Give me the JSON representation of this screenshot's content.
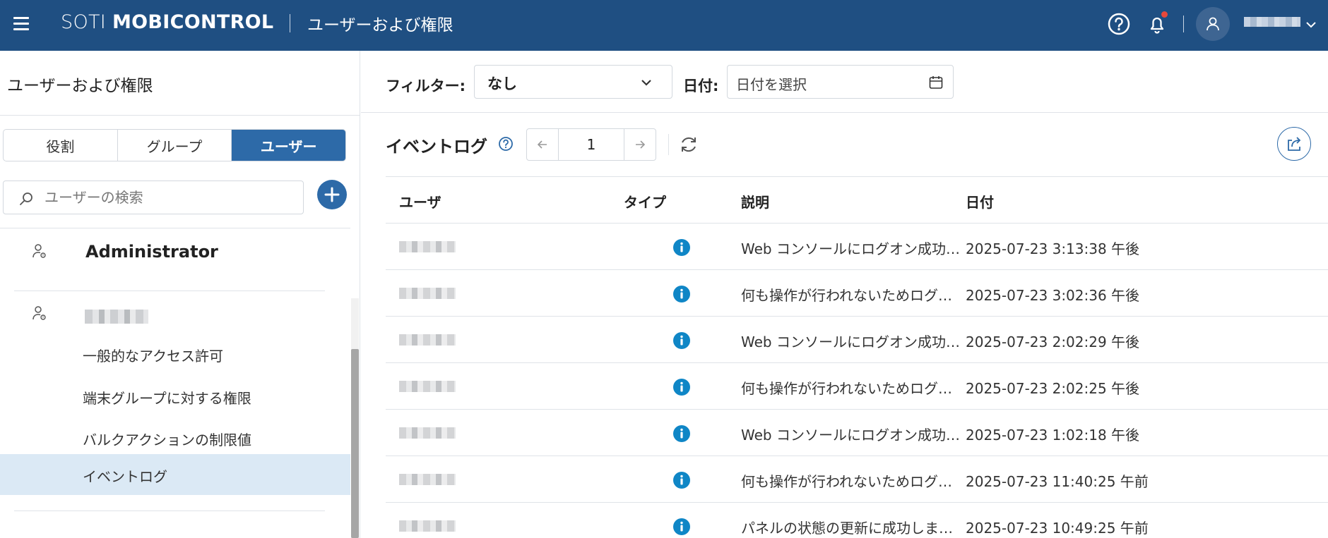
{
  "header": {
    "brand_soti": "SOTI",
    "brand_mobicontrol": "MOBICONTROL",
    "page_title": "ユーザーおよび権限"
  },
  "sidebar": {
    "title": "ユーザーおよび権限",
    "tabs": [
      {
        "label": "役割",
        "active": false
      },
      {
        "label": "グループ",
        "active": false
      },
      {
        "label": "ユーザー",
        "active": true
      }
    ],
    "search_placeholder": "ユーザーの検索",
    "users": [
      {
        "name": "Administrator"
      }
    ],
    "sub_items": [
      {
        "label": "一般的なアクセス許可",
        "selected": false
      },
      {
        "label": "端末グループに対する権限",
        "selected": false
      },
      {
        "label": "バルクアクションの制限値",
        "selected": false
      },
      {
        "label": "イベントログ",
        "selected": true
      }
    ]
  },
  "filters": {
    "filter_label": "フィルター:",
    "filter_value": "なし",
    "date_label": "日付:",
    "date_placeholder": "日付を選択"
  },
  "event_log": {
    "title": "イベントログ",
    "page": "1",
    "columns": [
      "ユーザ",
      "タイプ",
      "説明",
      "日付"
    ],
    "rows": [
      {
        "description": "Web コンソールにログオン成功…",
        "date": "2025-07-23 3:13:38 午後"
      },
      {
        "description": "何も操作が行われないためログ…",
        "date": "2025-07-23 3:02:36 午後"
      },
      {
        "description": "Web コンソールにログオン成功…",
        "date": "2025-07-23 2:02:29 午後"
      },
      {
        "description": "何も操作が行われないためログ…",
        "date": "2025-07-23 2:02:25 午後"
      },
      {
        "description": "Web コンソールにログオン成功…",
        "date": "2025-07-23 1:02:18 午後"
      },
      {
        "description": "何も操作が行われないためログ…",
        "date": "2025-07-23 11:40:25 午前"
      },
      {
        "description": "パネルの状態の更新に成功しま…",
        "date": "2025-07-23 10:49:25 午前"
      }
    ]
  },
  "colors": {
    "topbar": "#1f4f82",
    "accent": "#2d6aa8",
    "info_icon": "#0f86c6",
    "selected_row": "#dbe9f5"
  },
  "icons": [
    "menu-icon",
    "help-icon",
    "bell-icon",
    "user-avatar-icon",
    "chevron-down-icon",
    "search-icon",
    "plus-icon",
    "user-key-icon",
    "calendar-icon",
    "arrow-left-icon",
    "arrow-right-icon",
    "refresh-icon",
    "export-icon",
    "info-icon"
  ]
}
